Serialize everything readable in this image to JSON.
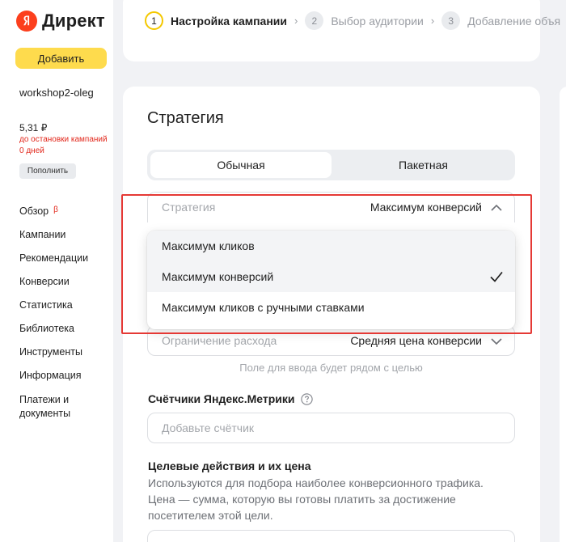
{
  "app": {
    "logo_text": "Директ",
    "add_button": "Добавить",
    "login": "workshop2-oleg",
    "balance": "5,31 ₽",
    "stop_warning": "до остановки кампаний 0 дней",
    "topup_button": "Пополнить",
    "beta_mark": "β",
    "nav": [
      "Обзор",
      "Кампании",
      "Рекомендации",
      "Конверсии",
      "Статистика",
      "Библиотека",
      "Инструменты",
      "Информация",
      "Платежи и документы"
    ]
  },
  "steps": [
    {
      "num": "1",
      "label": "Настройка кампании",
      "active": true
    },
    {
      "num": "2",
      "label": "Выбор аудитории",
      "active": false
    },
    {
      "num": "3",
      "label": "Добавление объя",
      "active": false
    }
  ],
  "strategy": {
    "title": "Стратегия",
    "tabs": [
      "Обычная",
      "Пакетная"
    ],
    "field_label": "Стратегия",
    "field_value": "Максимум конверсий",
    "options": [
      "Максимум кликов",
      "Максимум конверсий",
      "Максимум кликов с ручными ставками"
    ],
    "selected_index": 1,
    "limit_label": "Ограничение расхода",
    "limit_value": "Средняя цена конверсии",
    "hint": "Поле для ввода будет рядом с целью"
  },
  "metrika": {
    "title": "Счётчики Яндекс.Метрики",
    "placeholder": "Добавьте счётчик"
  },
  "goals": {
    "title": "Целевые действия и их цена",
    "description": "Используются для подбора наиболее конверсионного трафика. Цена — сумма, которую вы готовы платить за достижение посетителем этой цели."
  },
  "colors": {
    "accent_yellow": "#fedb4d",
    "highlight_red": "#e53935",
    "warning_red": "#e2271b"
  }
}
